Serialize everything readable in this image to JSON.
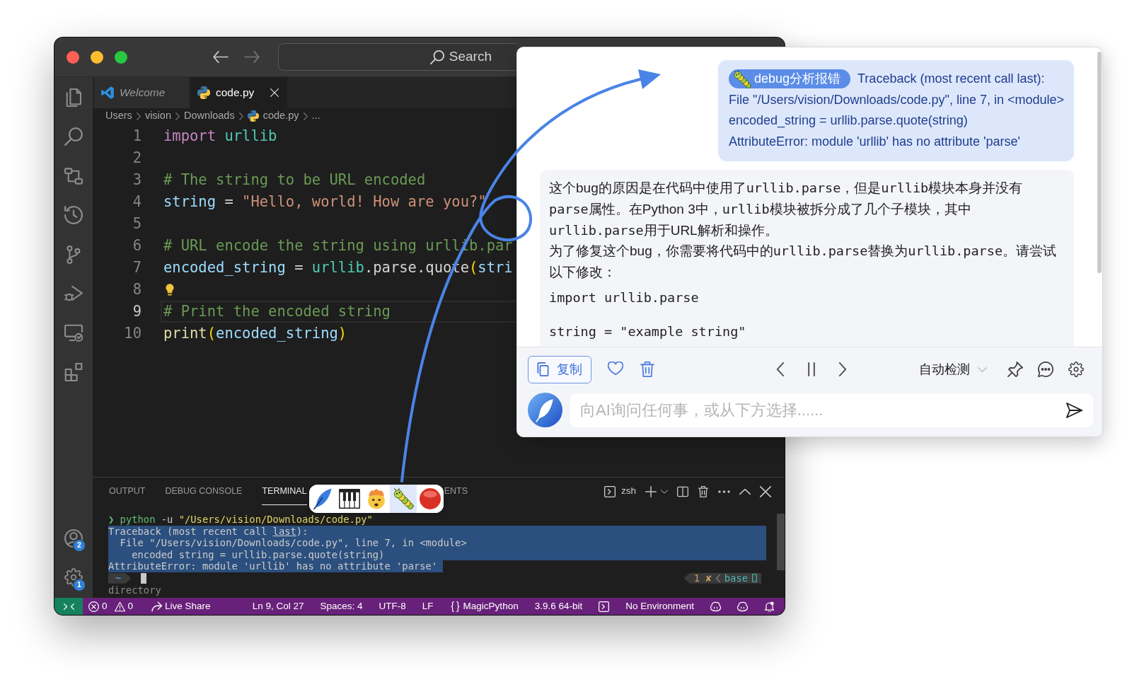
{
  "editor_window": {
    "command_center": {
      "label": "Search"
    },
    "activity_badges": {
      "accounts": "2",
      "manage": "1"
    },
    "tabs": [
      {
        "label": "Welcome",
        "kind": "welcome",
        "preview": true,
        "selected": false
      },
      {
        "label": "code.py",
        "kind": "python",
        "preview": false,
        "selected": true
      }
    ],
    "breadcrumb": [
      {
        "label": "Users",
        "kind": "folder"
      },
      {
        "label": "vision",
        "kind": "folder"
      },
      {
        "label": "Downloads",
        "kind": "folder"
      },
      {
        "label": "code.py",
        "kind": "python"
      },
      {
        "label": "...",
        "kind": "folder"
      }
    ],
    "lines": [
      {
        "number": "1",
        "current": false,
        "lightbulb": false,
        "tokens": [
          {
            "kind": "keyword",
            "text": "import"
          },
          {
            "kind": "module",
            "text": " urllib"
          }
        ]
      },
      {
        "number": "2",
        "current": false,
        "lightbulb": false
      },
      {
        "number": "3",
        "current": false,
        "lightbulb": false,
        "tokens": [
          {
            "kind": "comment",
            "text": "# The string to be URL encoded"
          }
        ]
      },
      {
        "number": "4",
        "current": false,
        "lightbulb": false,
        "tokens": [
          {
            "kind": "variable",
            "text": "string"
          },
          {
            "kind": "plain",
            "text": " = "
          },
          {
            "kind": "string",
            "text": "\"Hello, world! How are you?\""
          }
        ]
      },
      {
        "number": "5",
        "current": false,
        "lightbulb": false
      },
      {
        "number": "6",
        "current": false,
        "lightbulb": false,
        "tokens": [
          {
            "kind": "comment",
            "text": "# URL encode the string using urllib.par"
          }
        ]
      },
      {
        "number": "7",
        "current": false,
        "lightbulb": false,
        "tokens": [
          {
            "kind": "variable",
            "text": "encoded_string"
          },
          {
            "kind": "plain",
            "text": " = "
          },
          {
            "kind": "module",
            "text": "urllib"
          },
          {
            "kind": "plain",
            "text": ".parse.quote"
          },
          {
            "kind": "bracket",
            "text": "("
          },
          {
            "kind": "variable",
            "text": "stri"
          }
        ]
      },
      {
        "number": "8",
        "current": false,
        "lightbulb": true
      },
      {
        "number": "9",
        "current": true,
        "lightbulb": false,
        "tokens": [
          {
            "kind": "comment",
            "text": "# Print the encoded string"
          }
        ]
      },
      {
        "number": "10",
        "current": false,
        "lightbulb": false,
        "tokens": [
          {
            "kind": "function",
            "text": "print"
          },
          {
            "kind": "bracket",
            "text": "("
          },
          {
            "kind": "variable",
            "text": "encoded_string"
          },
          {
            "kind": "bracket",
            "text": ")"
          }
        ]
      }
    ],
    "panel": {
      "tabs": [
        {
          "label": "OUTPUT",
          "selected": false
        },
        {
          "label": "DEBUG CONSOLE",
          "selected": false
        },
        {
          "label": "TERMINAL",
          "selected": true
        },
        {
          "label": "ENTS",
          "selected": false
        }
      ],
      "terminal_name": "zsh",
      "terminal_lines": [
        {
          "kind": "text",
          "selected": false,
          "tokens": [
            {
              "kind": "command",
              "text": "❯ python"
            },
            {
              "kind": "plain",
              "text": " -u "
            },
            {
              "kind": "string",
              "text": "\"/Users/vision/Downloads/code.py\""
            }
          ]
        },
        {
          "kind": "text",
          "selected": true,
          "tokens": [
            {
              "kind": "plain",
              "text": "Traceback (most recent call "
            },
            {
              "kind": "link",
              "text": "last"
            },
            {
              "kind": "plain",
              "text": "):"
            }
          ]
        },
        {
          "kind": "text",
          "selected": true,
          "tokens": [
            {
              "kind": "plain",
              "text": "  File \"/Users/vision/Downloads/code.py\", line 7, in <module>"
            }
          ]
        },
        {
          "kind": "text",
          "selected": true,
          "tokens": [
            {
              "kind": "plain",
              "text": "    encoded_string = urllib.parse.quote(string)"
            }
          ]
        },
        {
          "kind": "text",
          "selected": true,
          "tokens": [
            {
              "kind": "plain",
              "text": "AttributeError: module 'urllib' has no attribute 'parse'"
            }
          ]
        },
        {
          "kind": "prompt",
          "selected": false,
          "directory": "~",
          "status": "1 ✘",
          "environment": "base"
        },
        {
          "kind": "text",
          "selected": false,
          "tokens": [
            {
              "kind": "dim",
              "text": "directory"
            }
          ]
        }
      ]
    },
    "status_bar": {
      "errors": "0",
      "warnings": "0",
      "live_share": "Live Share",
      "cursor": "Ln 9, Col 27",
      "indentation": "Spaces: 4",
      "encoding": "UTF-8",
      "line_ending": "LF",
      "language": "MagicPython",
      "interpreter": "3.9.6 64-bit",
      "environment": "No Environment"
    }
  },
  "shortcut_popup": {
    "items": [
      {
        "kind": "feather",
        "selected": false
      },
      {
        "kind": "piano",
        "selected": false
      },
      {
        "kind": "face",
        "selected": false
      },
      {
        "kind": "caterpillar",
        "selected": true
      },
      {
        "kind": "disc",
        "selected": false
      }
    ]
  },
  "chat_panel": {
    "user_message": {
      "tag": "debug分析报错",
      "lines": [
        "Traceback (most recent call last):",
        "File \"/Users/vision/Downloads/code.py\", line 7, in <module>",
        "encoded_string = urllib.parse.quote(string)",
        "AttributeError: module 'urllib' has no attribute 'parse'"
      ]
    },
    "reply": {
      "paragraphs": [
        [
          {
            "kind": "text",
            "text": "这个bug的原因是在代码中使用了"
          },
          {
            "kind": "code",
            "text": "urllib.parse"
          },
          {
            "kind": "text",
            "text": "，但是"
          },
          {
            "kind": "code",
            "text": "urllib"
          },
          {
            "kind": "text",
            "text": "模块本身并没有"
          },
          {
            "kind": "code",
            "text": "parse"
          },
          {
            "kind": "text",
            "text": "属性。在Python 3中，"
          },
          {
            "kind": "code",
            "text": "urllib"
          },
          {
            "kind": "text",
            "text": "模块被拆分成了几个子模块，其中"
          },
          {
            "kind": "code",
            "text": "urllib.parse"
          },
          {
            "kind": "text",
            "text": "用于URL解析和操作。"
          }
        ],
        [
          {
            "kind": "text",
            "text": "为了修复这个bug，你需要将代码中的"
          },
          {
            "kind": "code",
            "text": "urllib.parse"
          },
          {
            "kind": "text",
            "text": "替换为"
          },
          {
            "kind": "code",
            "text": "urllib.parse"
          },
          {
            "kind": "text",
            "text": "。请尝试以下修改："
          }
        ]
      ],
      "code": "import urllib.parse\n\nstring = \"example string\""
    },
    "toolbar": {
      "copy": "复制",
      "language": "自动检测"
    },
    "input": {
      "placeholder": "向AI询问任何事，或从下方选择......"
    }
  }
}
